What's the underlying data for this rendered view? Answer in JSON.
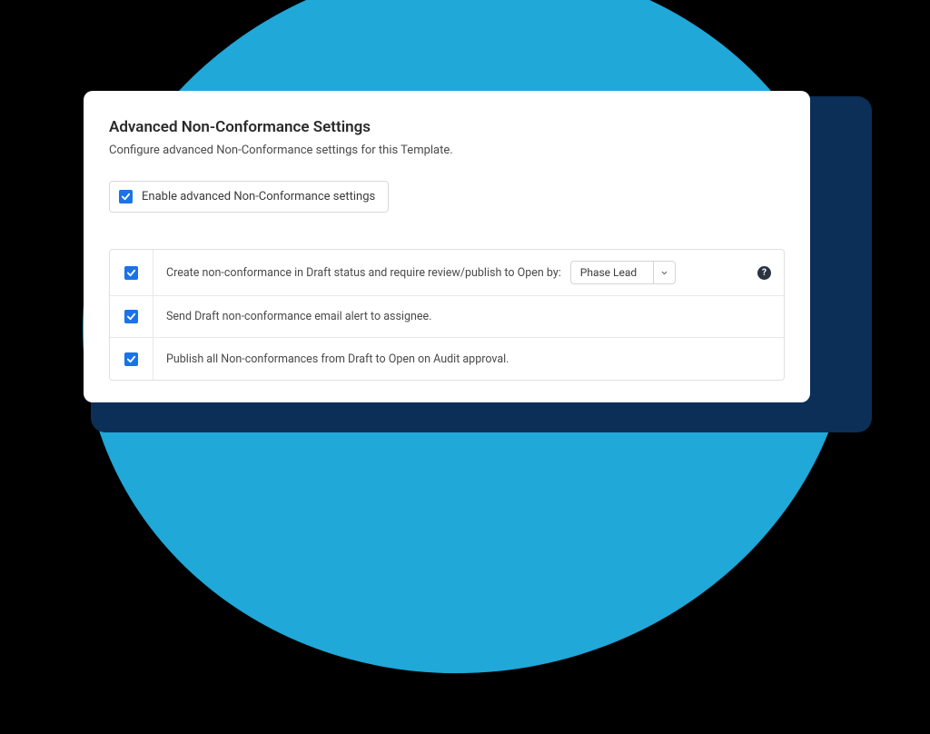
{
  "header": {
    "title": "Advanced Non-Conformance Settings",
    "subtitle": "Configure advanced Non-Conformance settings for this Template."
  },
  "enable": {
    "label": "Enable advanced Non-Conformance settings",
    "checked": true
  },
  "settings": {
    "rows": [
      {
        "text": "Create non-conformance in Draft status and require review/publish to Open by:",
        "checked": true,
        "hasDropdown": true,
        "dropdownValue": "Phase Lead",
        "hasHelp": true
      },
      {
        "text": "Send Draft non-conformance email alert to assignee.",
        "checked": true,
        "hasDropdown": false,
        "hasHelp": false
      },
      {
        "text": "Publish all Non-conformances from Draft to Open on Audit approval.",
        "checked": true,
        "hasDropdown": false,
        "hasHelp": false
      }
    ]
  },
  "icons": {
    "help": "?"
  }
}
